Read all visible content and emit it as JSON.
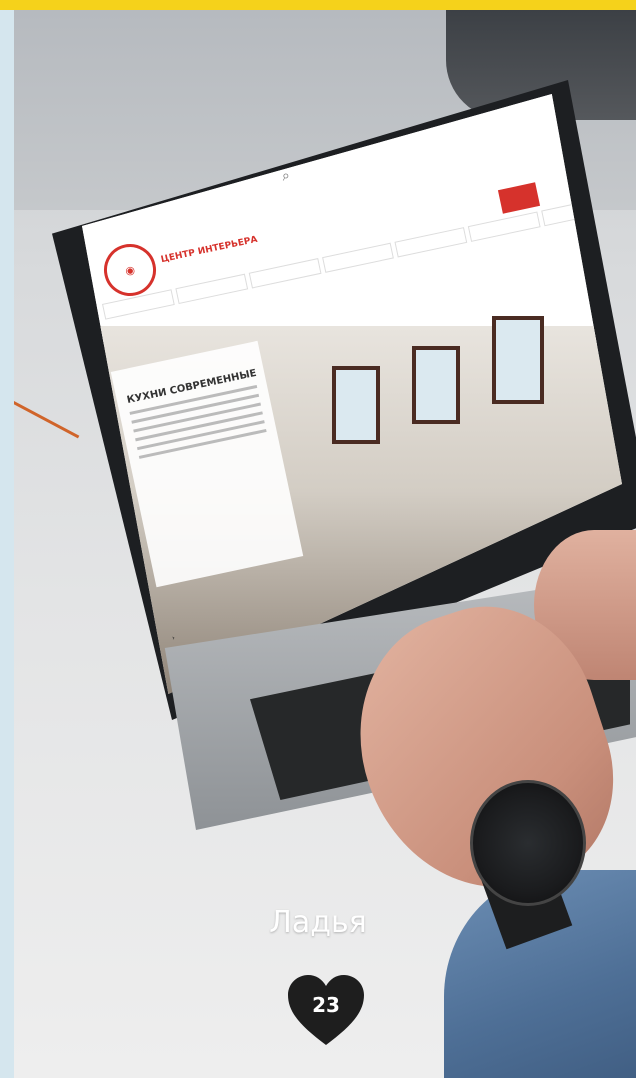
{
  "caption": "Ладья",
  "badge": {
    "number": "23",
    "icon": "heart-icon",
    "color": "#1e1e1e"
  },
  "colors": {
    "frame_top": "#f5d21b",
    "frame_left": "#d5e6ee",
    "brand_red": "#d6322c"
  },
  "screen_site": {
    "logo_text": "ЦЕНТР ИНТЕРЬЕРА",
    "hero_title": "КУХНИ СОВРЕМЕННЫЕ"
  }
}
